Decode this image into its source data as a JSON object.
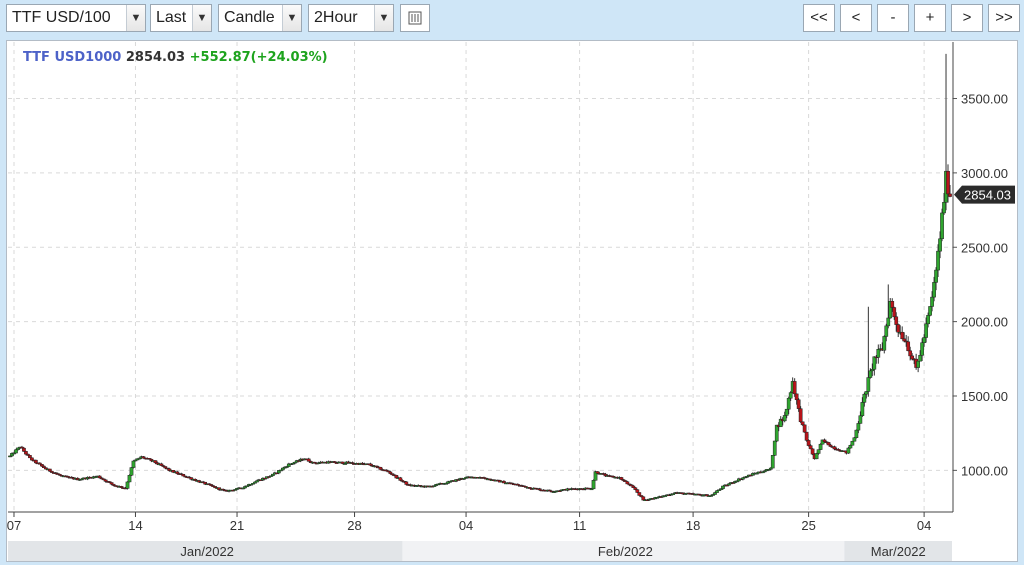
{
  "toolbar": {
    "symbol_select": "TTF USD/100",
    "price_type_select": "Last",
    "chart_style_select": "Candle",
    "interval_select": "2Hour",
    "nav": [
      "<<",
      "<",
      "-",
      "+",
      ">",
      ">>"
    ]
  },
  "icons": {
    "dropdown": "chevron-down-icon",
    "table": "table-icon"
  },
  "colors": {
    "up": "#2fa52f",
    "down": "#b8141a",
    "symbol_label": "#4d62c8",
    "change_text": "#1da31d",
    "price_tag": "#2b2b2b"
  },
  "header": {
    "symbol": "TTF USD1000",
    "last": "2854.03",
    "change": "+552.87(+24.03%)"
  },
  "chart_data": {
    "type": "candlestick",
    "title": "",
    "xlabel": "",
    "ylabel": "",
    "ylim": [
      720,
      3880
    ],
    "y_ticks": [
      "1000.00",
      "1500.00",
      "2000.00",
      "2500.00",
      "3000.00",
      "3500.00"
    ],
    "grid": true,
    "last_price_label": "2854.03",
    "x_day_ticks": [
      {
        "label": "07",
        "bar": 2
      },
      {
        "label": "14",
        "bar": 63
      },
      {
        "label": "21",
        "bar": 114
      },
      {
        "label": "28",
        "bar": 173
      },
      {
        "label": "04",
        "bar": 229
      },
      {
        "label": "11",
        "bar": 286
      },
      {
        "label": "18",
        "bar": 343
      },
      {
        "label": "25",
        "bar": 401
      },
      {
        "label": "04",
        "bar": 459
      }
    ],
    "month_bands": [
      {
        "label": "Jan/2022",
        "start_bar": 0,
        "end_bar": 198
      },
      {
        "label": "Feb/2022",
        "start_bar": 198,
        "end_bar": 420
      },
      {
        "label": "Mar/2022",
        "start_bar": 420,
        "end_bar": 472
      }
    ],
    "close_path": [
      [
        0,
        1095
      ],
      [
        5,
        1160
      ],
      [
        10,
        1080
      ],
      [
        18,
        1010
      ],
      [
        26,
        960
      ],
      [
        34,
        940
      ],
      [
        44,
        960
      ],
      [
        52,
        900
      ],
      [
        58,
        880
      ],
      [
        62,
        1060
      ],
      [
        66,
        1090
      ],
      [
        72,
        1060
      ],
      [
        80,
        1000
      ],
      [
        90,
        950
      ],
      [
        100,
        900
      ],
      [
        108,
        860
      ],
      [
        116,
        880
      ],
      [
        124,
        930
      ],
      [
        132,
        970
      ],
      [
        140,
        1040
      ],
      [
        148,
        1080
      ],
      [
        152,
        1050
      ],
      [
        160,
        1055
      ],
      [
        170,
        1050
      ],
      [
        180,
        1040
      ],
      [
        190,
        990
      ],
      [
        200,
        900
      ],
      [
        210,
        890
      ],
      [
        220,
        920
      ],
      [
        228,
        950
      ],
      [
        236,
        955
      ],
      [
        244,
        930
      ],
      [
        252,
        910
      ],
      [
        262,
        880
      ],
      [
        272,
        860
      ],
      [
        282,
        875
      ],
      [
        292,
        880
      ],
      [
        294,
        990
      ],
      [
        300,
        960
      ],
      [
        306,
        950
      ],
      [
        314,
        870
      ],
      [
        318,
        800
      ],
      [
        326,
        820
      ],
      [
        334,
        850
      ],
      [
        342,
        840
      ],
      [
        352,
        830
      ],
      [
        358,
        890
      ],
      [
        366,
        940
      ],
      [
        374,
        980
      ],
      [
        382,
        1010
      ],
      [
        385,
        1300
      ],
      [
        389,
        1360
      ],
      [
        393,
        1600
      ],
      [
        396,
        1400
      ],
      [
        400,
        1200
      ],
      [
        404,
        1080
      ],
      [
        408,
        1200
      ],
      [
        414,
        1150
      ],
      [
        420,
        1120
      ],
      [
        424,
        1220
      ],
      [
        430,
        1550
      ],
      [
        434,
        1750
      ],
      [
        438,
        1820
      ],
      [
        442,
        2130
      ],
      [
        446,
        1950
      ],
      [
        450,
        1870
      ],
      [
        455,
        1680
      ],
      [
        459,
        1900
      ],
      [
        463,
        2150
      ],
      [
        466,
        2450
      ],
      [
        468,
        2700
      ],
      [
        470,
        2960
      ],
      [
        472,
        2854
      ]
    ]
  }
}
